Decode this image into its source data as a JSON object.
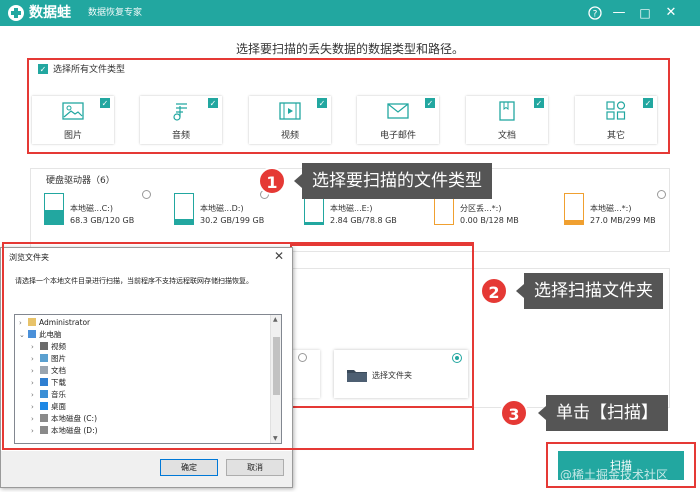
{
  "app": {
    "name": "数据蛙",
    "subtitle": "数据恢复专家",
    "accent_color": "#22a7a0",
    "controls": [
      "?",
      "—",
      "□",
      "✕"
    ]
  },
  "heading": "选择要扫描的丢失数据的数据类型和路径。",
  "file_types": {
    "select_all_label": "选择所有文件类型",
    "select_all_checked": true,
    "items": [
      {
        "label": "图片",
        "icon": "image-icon",
        "checked": true
      },
      {
        "label": "音频",
        "icon": "music-icon",
        "checked": true
      },
      {
        "label": "视频",
        "icon": "video-icon",
        "checked": true
      },
      {
        "label": "电子邮件",
        "icon": "email-icon",
        "checked": true
      },
      {
        "label": "文档",
        "icon": "document-icon",
        "checked": true
      },
      {
        "label": "其它",
        "icon": "other-icon",
        "checked": true
      }
    ]
  },
  "drives": {
    "section_label": "硬盘驱动器（6）",
    "items": [
      {
        "name": "本地磁...C:)",
        "size": "68.3 GB/120 GB"
      },
      {
        "name": "本地磁...D:)",
        "size": "30.2 GB/199 GB"
      },
      {
        "name": "本地磁...E:)",
        "size": "2.84 GB/78.8 GB"
      },
      {
        "name": "分区丢...*:)",
        "size": "0.00  B/128 MB"
      },
      {
        "name": "本地磁...*:)",
        "size": "27.0 MB/299 MB"
      }
    ]
  },
  "folder_option": {
    "label": "选择文件夹",
    "selected": true
  },
  "dialog": {
    "title": "浏览文件夹",
    "close": "✕",
    "message": "请选择一个本地文件目录进行扫描，当前程序不支持远程联网存储扫描恢复。",
    "tree": [
      {
        "label": "Administrator",
        "level": 0,
        "expanded": false,
        "icon": "user-folder-icon"
      },
      {
        "label": "此电脑",
        "level": 0,
        "expanded": true,
        "icon": "computer-icon"
      },
      {
        "label": "视频",
        "level": 1,
        "expanded": false,
        "icon": "video-folder-icon"
      },
      {
        "label": "图片",
        "level": 1,
        "expanded": false,
        "icon": "pictures-folder-icon"
      },
      {
        "label": "文档",
        "level": 1,
        "expanded": false,
        "icon": "documents-folder-icon"
      },
      {
        "label": "下载",
        "level": 1,
        "expanded": false,
        "icon": "download-folder-icon"
      },
      {
        "label": "音乐",
        "level": 1,
        "expanded": false,
        "icon": "music-folder-icon"
      },
      {
        "label": "桌面",
        "level": 1,
        "expanded": false,
        "icon": "desktop-folder-icon"
      },
      {
        "label": "本地磁盘 (C:)",
        "level": 1,
        "expanded": false,
        "icon": "drive-icon"
      },
      {
        "label": "本地磁盘 (D:)",
        "level": 1,
        "expanded": false,
        "icon": "drive-icon"
      }
    ],
    "ok_label": "确定",
    "cancel_label": "取消"
  },
  "callouts": [
    {
      "number": "1",
      "text": "选择要扫描的文件类型"
    },
    {
      "number": "2",
      "text": "选择扫描文件夹"
    },
    {
      "number": "3",
      "text": "单击【扫描】"
    }
  ],
  "scan_button": "扫描",
  "watermark": "@稀土掘金技术社区",
  "highlight_color": "#e53935"
}
